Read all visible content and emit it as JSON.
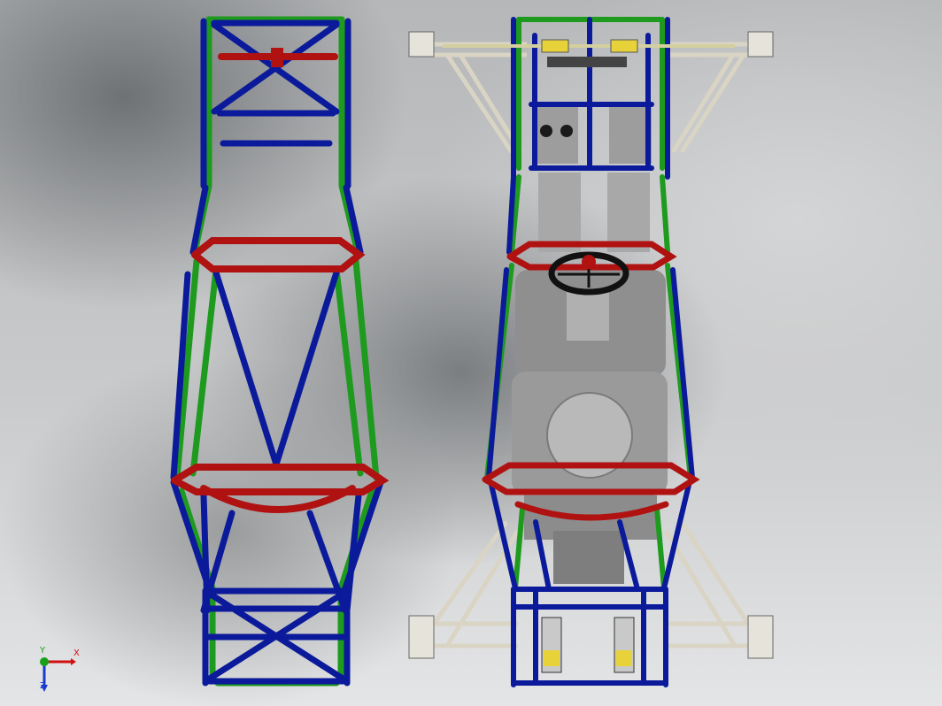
{
  "viewport": {
    "title": "",
    "background_top": "#b5b7b9",
    "background_bottom": "#e4e5e6"
  },
  "colors": {
    "frame_blue": "#0b1a9a",
    "frame_green": "#1e9a1e",
    "frame_red": "#b01212",
    "steering_wheel": "#111111",
    "suspension_arm": "#d9d4c4",
    "seat_gray": "#9a9a9a",
    "spring_yellow": "#e8d23a"
  },
  "triad": {
    "x_label": "X",
    "y_label": "Y",
    "z_label": "Z",
    "x_color": "#d01010",
    "y_color": "#18a018",
    "z_color": "#1a3ad0"
  },
  "models": [
    {
      "name": "bare-frame-top-view"
    },
    {
      "name": "assembled-vehicle-top-view"
    }
  ]
}
